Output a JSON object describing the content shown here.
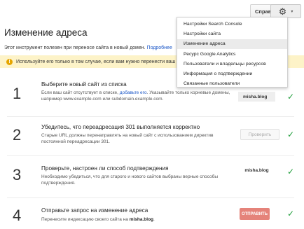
{
  "topbar": {
    "help_label": "Справка",
    "help_caret": "▾",
    "gear_icon": "⚙",
    "gear_caret": "▾"
  },
  "page": {
    "title": "Изменение адреса",
    "intro_text": "Этот инструмент полезен при переносе сайта в новый домен. ",
    "intro_link": "Подробнее",
    "warning_icon": "!",
    "warning": "Используйте его только в том случае, если вам нужно перенести ваш"
  },
  "steps": [
    {
      "number": "1",
      "title": "Выберите новый сайт из списка",
      "desc_before": "Если ваш сайт отсутствует в списке, ",
      "desc_link": "добавьте его",
      "desc_after": ". Указывайте только корневые домены, например www.example.com или subdomain.example.com.",
      "site": "misha.blog",
      "check": "✓"
    },
    {
      "number": "2",
      "title": "Убедитесь, что переадресация 301 выполняется корректно",
      "desc": "Старые URL должны перенаправлять на новый сайт с использованием директив постоянной переадресации 301.",
      "button": "Проверить",
      "check": "✓"
    },
    {
      "number": "3",
      "title": "Проверьте, настроен ли способ подтверждения",
      "desc": "Необходимо убедиться, что для старого и нового сайтов выбраны верные способы подтверждения.",
      "site": "misha.blog",
      "check": "✓"
    },
    {
      "number": "4",
      "title": "Отправьте запрос на изменение адреса",
      "desc_before": "Перенесите индексацию своего сайта на ",
      "desc_bold": "misha.blog",
      "desc_after": ".",
      "button": "ОТПРАВИТЬ",
      "check": "✓"
    }
  ],
  "dropdown": {
    "items": [
      "Настройки Search Console",
      "Настройки сайта",
      "Изменение адреса",
      "Ресурс Google Analytics",
      "Пользователи и владельцы ресурсов",
      "Информация о подтверждении",
      "Связанные пользователи"
    ],
    "selected_index": 2
  },
  "colors": {
    "link": "#1a56c7",
    "check": "#1e9e3a",
    "send_button": "#e5837a",
    "warning_bg": "#fdf3c8",
    "selected_item_bg": "#ebebeb"
  }
}
